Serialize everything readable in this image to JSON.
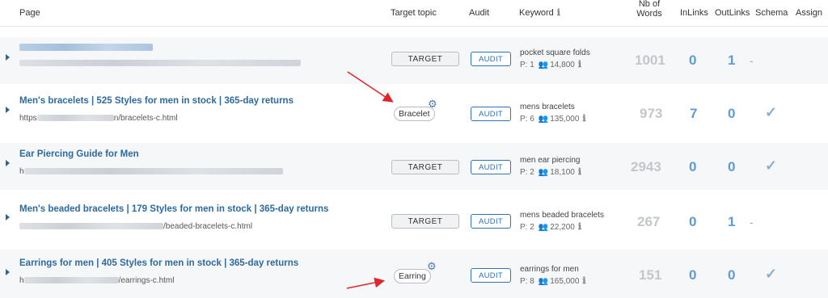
{
  "header": {
    "page": "Page",
    "target_topic": "Target topic",
    "audit": "Audit",
    "keyword": "Keyword",
    "nb_words_l1": "Nb of",
    "nb_words_l2": "Words",
    "inlinks": "InLinks",
    "outlinks": "OutLinks",
    "schema": "Schema",
    "assign": "Assign"
  },
  "rows": [
    {
      "title": "",
      "url_suffix": "",
      "topic_type": "button",
      "target_label": "TARGET",
      "audit_label": "AUDIT",
      "keyword": "pocket square folds",
      "position": "P: 1",
      "volume": "14,800",
      "words": "1001",
      "inlinks": "0",
      "outlinks": "1",
      "schema": "-"
    },
    {
      "title": "Men's bracelets | 525 Styles for men in stock | 365-day returns",
      "url_prefix": "https",
      "url_suffix": "n/bracelets-c.html",
      "topic_type": "pill",
      "topic": "Bracelet",
      "audit_label": "AUDIT",
      "keyword": "mens bracelets",
      "position": "P: 6",
      "volume": "135,000",
      "words": "973",
      "inlinks": "7",
      "outlinks": "0",
      "schema": "✓"
    },
    {
      "title": "Ear Piercing Guide for Men",
      "url_prefix": "h",
      "url_suffix": "",
      "topic_type": "button",
      "target_label": "TARGET",
      "audit_label": "AUDIT",
      "keyword": "men ear piercing",
      "position": "P: 2",
      "volume": "18,100",
      "words": "2943",
      "inlinks": "0",
      "outlinks": "0",
      "schema": "✓"
    },
    {
      "title": "Men's beaded bracelets | 179 Styles for men in stock | 365-day returns",
      "url_prefix": "",
      "url_suffix": "/beaded-bracelets-c.html",
      "topic_type": "button",
      "target_label": "TARGET",
      "audit_label": "AUDIT",
      "keyword": "mens beaded bracelets",
      "position": "P: 2",
      "volume": "22,200",
      "words": "267",
      "inlinks": "0",
      "outlinks": "1",
      "schema": "-"
    },
    {
      "title": "Earrings for men | 405 Styles for men in stock | 365-day returns",
      "url_prefix": "h",
      "url_suffix": "/earrings-c.html",
      "topic_type": "pill",
      "topic": "Earring",
      "audit_label": "AUDIT",
      "keyword": "earrings for men",
      "position": "P: 8",
      "volume": "165,000",
      "words": "151",
      "inlinks": "0",
      "outlinks": "0",
      "schema": "✓"
    }
  ],
  "icons": {
    "info": "info-icon",
    "people": "people-icon",
    "gear": "gear-icon",
    "check": "checkmark-icon",
    "expand": "chevron-right-icon"
  },
  "colors": {
    "title_link": "#2c6aa0",
    "audit_blue": "#2e72b8",
    "link_count_blue": "#5f9bd5",
    "word_count_grey": "#c3c7cb",
    "annotation_arrow": "#e0262b"
  }
}
